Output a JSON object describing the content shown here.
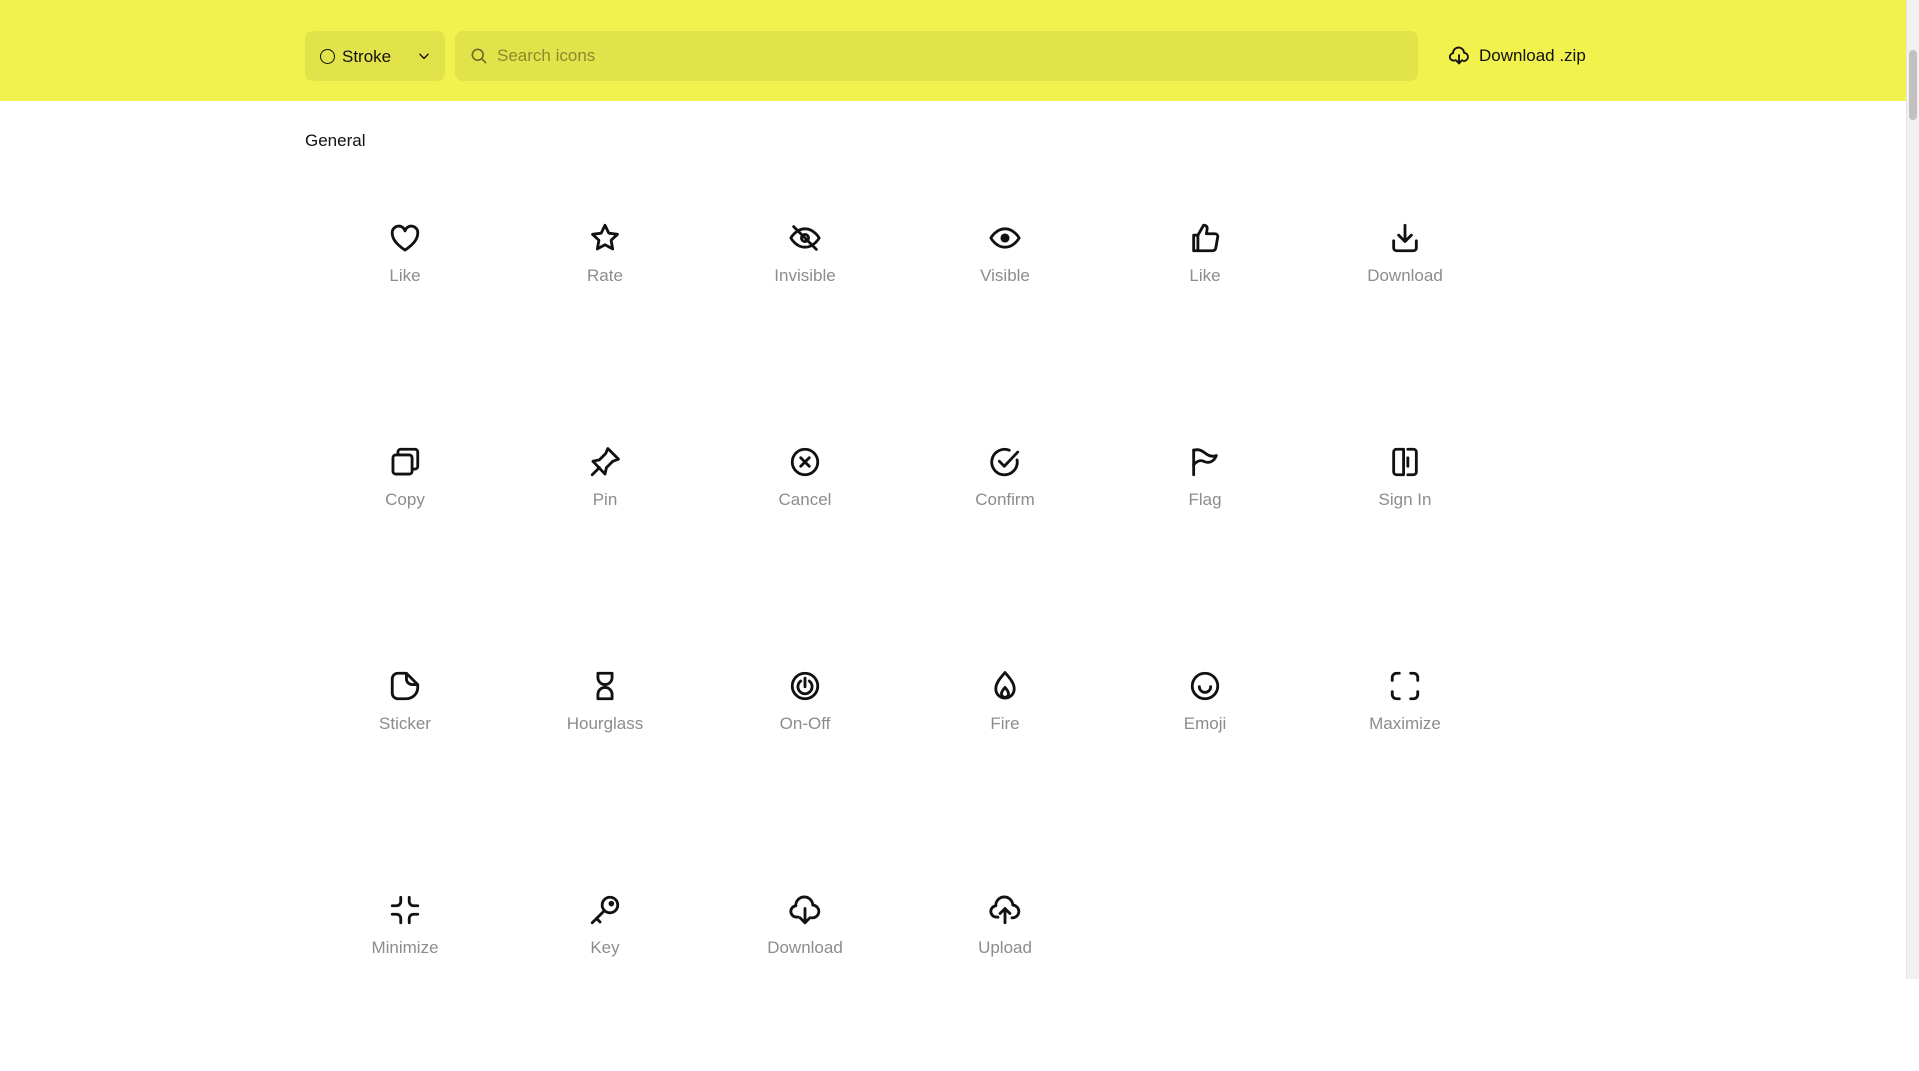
{
  "header": {
    "style_select": {
      "value": "Stroke",
      "icon": "circle-icon"
    },
    "search": {
      "placeholder": "Search icons",
      "value": ""
    },
    "download_zip_label": "Download .zip",
    "background_color": "#f2f24f"
  },
  "section": {
    "title": "General"
  },
  "icons": [
    {
      "label": "Like",
      "icon": "heart-icon"
    },
    {
      "label": "Rate",
      "icon": "star-icon"
    },
    {
      "label": "Invisible",
      "icon": "eye-off-icon"
    },
    {
      "label": "Visible",
      "icon": "eye-icon"
    },
    {
      "label": "Like",
      "icon": "thumbs-up-icon"
    },
    {
      "label": "Download",
      "icon": "download-tray-icon"
    },
    {
      "label": "Copy",
      "icon": "copy-icon"
    },
    {
      "label": "Pin",
      "icon": "pin-icon"
    },
    {
      "label": "Cancel",
      "icon": "x-circle-icon"
    },
    {
      "label": "Confirm",
      "icon": "check-circle-icon"
    },
    {
      "label": "Flag",
      "icon": "flag-icon"
    },
    {
      "label": "Sign In",
      "icon": "sign-in-icon"
    },
    {
      "label": "Sticker",
      "icon": "sticker-icon"
    },
    {
      "label": "Hourglass",
      "icon": "hourglass-icon"
    },
    {
      "label": "On-Off",
      "icon": "power-icon"
    },
    {
      "label": "Fire",
      "icon": "fire-icon"
    },
    {
      "label": "Emoji",
      "icon": "smile-icon"
    },
    {
      "label": "Maximize",
      "icon": "maximize-icon"
    },
    {
      "label": "Minimize",
      "icon": "minimize-icon"
    },
    {
      "label": "Key",
      "icon": "key-icon"
    },
    {
      "label": "Download",
      "icon": "cloud-download-icon"
    },
    {
      "label": "Upload",
      "icon": "cloud-upload-icon"
    }
  ]
}
